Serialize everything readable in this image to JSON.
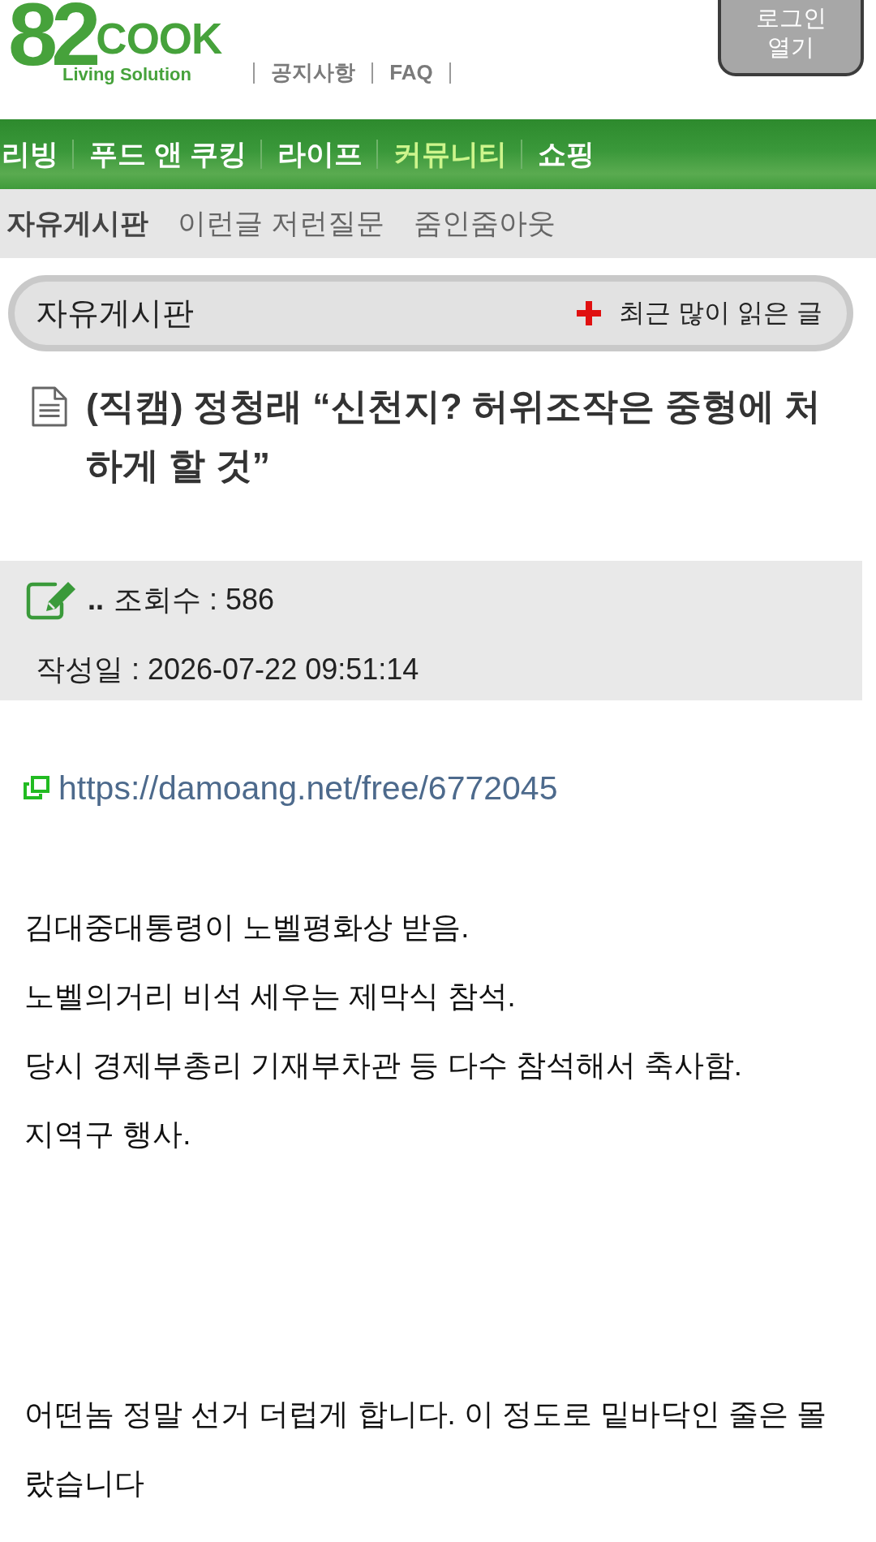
{
  "header": {
    "logo": {
      "number": "82",
      "word": "COOK",
      "tagline": "Living Solution"
    },
    "links": [
      "공지사항",
      "FAQ"
    ],
    "login_button": [
      "로그인",
      "열기"
    ]
  },
  "nav": [
    {
      "label": "리빙",
      "selected": false
    },
    {
      "label": "푸드 앤 쿠킹",
      "selected": false
    },
    {
      "label": "라이프",
      "selected": false
    },
    {
      "label": "커뮤니티",
      "selected": true
    },
    {
      "label": "쇼핑",
      "selected": false
    }
  ],
  "subnav": [
    {
      "label": "자유게시판",
      "selected": true
    },
    {
      "label": "이런글 저런질문",
      "selected": false
    },
    {
      "label": "줌인줌아웃",
      "selected": false
    }
  ],
  "board": {
    "title": "자유게시판",
    "popular_link": "최근 많이 읽은 글"
  },
  "post": {
    "title": "(직캠) 정청래 “신천지? 허위조작은 중형에 처하게 할 것”",
    "author": "..",
    "views": "조회수 : 586",
    "date": "작성일 : 2026-07-22 09:51:14",
    "link": "https://damoang.net/free/6772045",
    "body": [
      {
        "lines": [
          "김대중대통령이 노벨평화상 받음.",
          "노벨의거리 비석 세우는 제막식 참석.",
          "당시 경제부총리 기재부차관 등 다수 참석해서 축사함.",
          "지역구 행사."
        ]
      },
      {
        "lines": [
          "어떤놈 정말 선거 더럽게 합니다. 이 정도로 밑바닥인 줄은 몰랐습니다"
        ]
      }
    ]
  }
}
